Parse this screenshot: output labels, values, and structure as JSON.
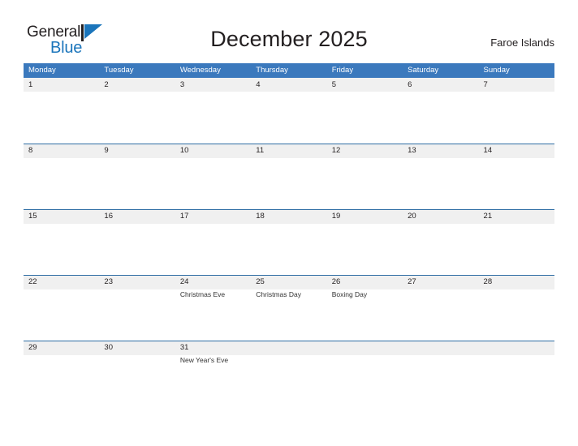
{
  "brand": {
    "name_part1": "General",
    "name_part2": "Blue",
    "flag_icon": "blue-flag-triangle",
    "color_dark": "#231f20",
    "color_blue": "#1b75bb"
  },
  "header": {
    "title": "December 2025",
    "region": "Faroe Islands"
  },
  "theme": {
    "header_bar": "#3b79bd",
    "band": "#f0f0f0",
    "rule": "#2e6da4",
    "text": "#231f20"
  },
  "calendar": {
    "weekdays": [
      "Monday",
      "Tuesday",
      "Wednesday",
      "Thursday",
      "Friday",
      "Saturday",
      "Sunday"
    ],
    "weeks": [
      [
        {
          "date": "1",
          "event": ""
        },
        {
          "date": "2",
          "event": ""
        },
        {
          "date": "3",
          "event": ""
        },
        {
          "date": "4",
          "event": ""
        },
        {
          "date": "5",
          "event": ""
        },
        {
          "date": "6",
          "event": ""
        },
        {
          "date": "7",
          "event": ""
        }
      ],
      [
        {
          "date": "8",
          "event": ""
        },
        {
          "date": "9",
          "event": ""
        },
        {
          "date": "10",
          "event": ""
        },
        {
          "date": "11",
          "event": ""
        },
        {
          "date": "12",
          "event": ""
        },
        {
          "date": "13",
          "event": ""
        },
        {
          "date": "14",
          "event": ""
        }
      ],
      [
        {
          "date": "15",
          "event": ""
        },
        {
          "date": "16",
          "event": ""
        },
        {
          "date": "17",
          "event": ""
        },
        {
          "date": "18",
          "event": ""
        },
        {
          "date": "19",
          "event": ""
        },
        {
          "date": "20",
          "event": ""
        },
        {
          "date": "21",
          "event": ""
        }
      ],
      [
        {
          "date": "22",
          "event": ""
        },
        {
          "date": "23",
          "event": ""
        },
        {
          "date": "24",
          "event": "Christmas Eve"
        },
        {
          "date": "25",
          "event": "Christmas Day"
        },
        {
          "date": "26",
          "event": "Boxing Day"
        },
        {
          "date": "27",
          "event": ""
        },
        {
          "date": "28",
          "event": ""
        }
      ],
      [
        {
          "date": "29",
          "event": ""
        },
        {
          "date": "30",
          "event": ""
        },
        {
          "date": "31",
          "event": "New Year's Eve"
        },
        {
          "date": "",
          "event": ""
        },
        {
          "date": "",
          "event": ""
        },
        {
          "date": "",
          "event": ""
        },
        {
          "date": "",
          "event": ""
        }
      ]
    ]
  }
}
